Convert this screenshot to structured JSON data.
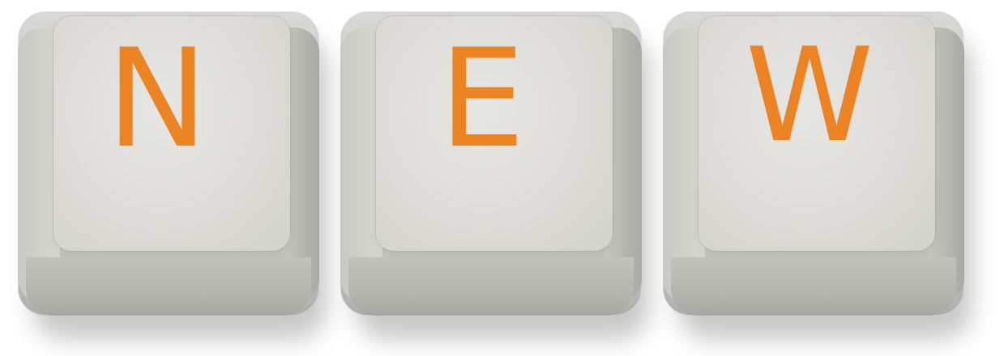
{
  "keys": [
    {
      "label": "N"
    },
    {
      "label": "E"
    },
    {
      "label": "W"
    }
  ],
  "colors": {
    "letter": "#ec8424",
    "keycap": "#dddcd8",
    "background": "#ffffff"
  }
}
